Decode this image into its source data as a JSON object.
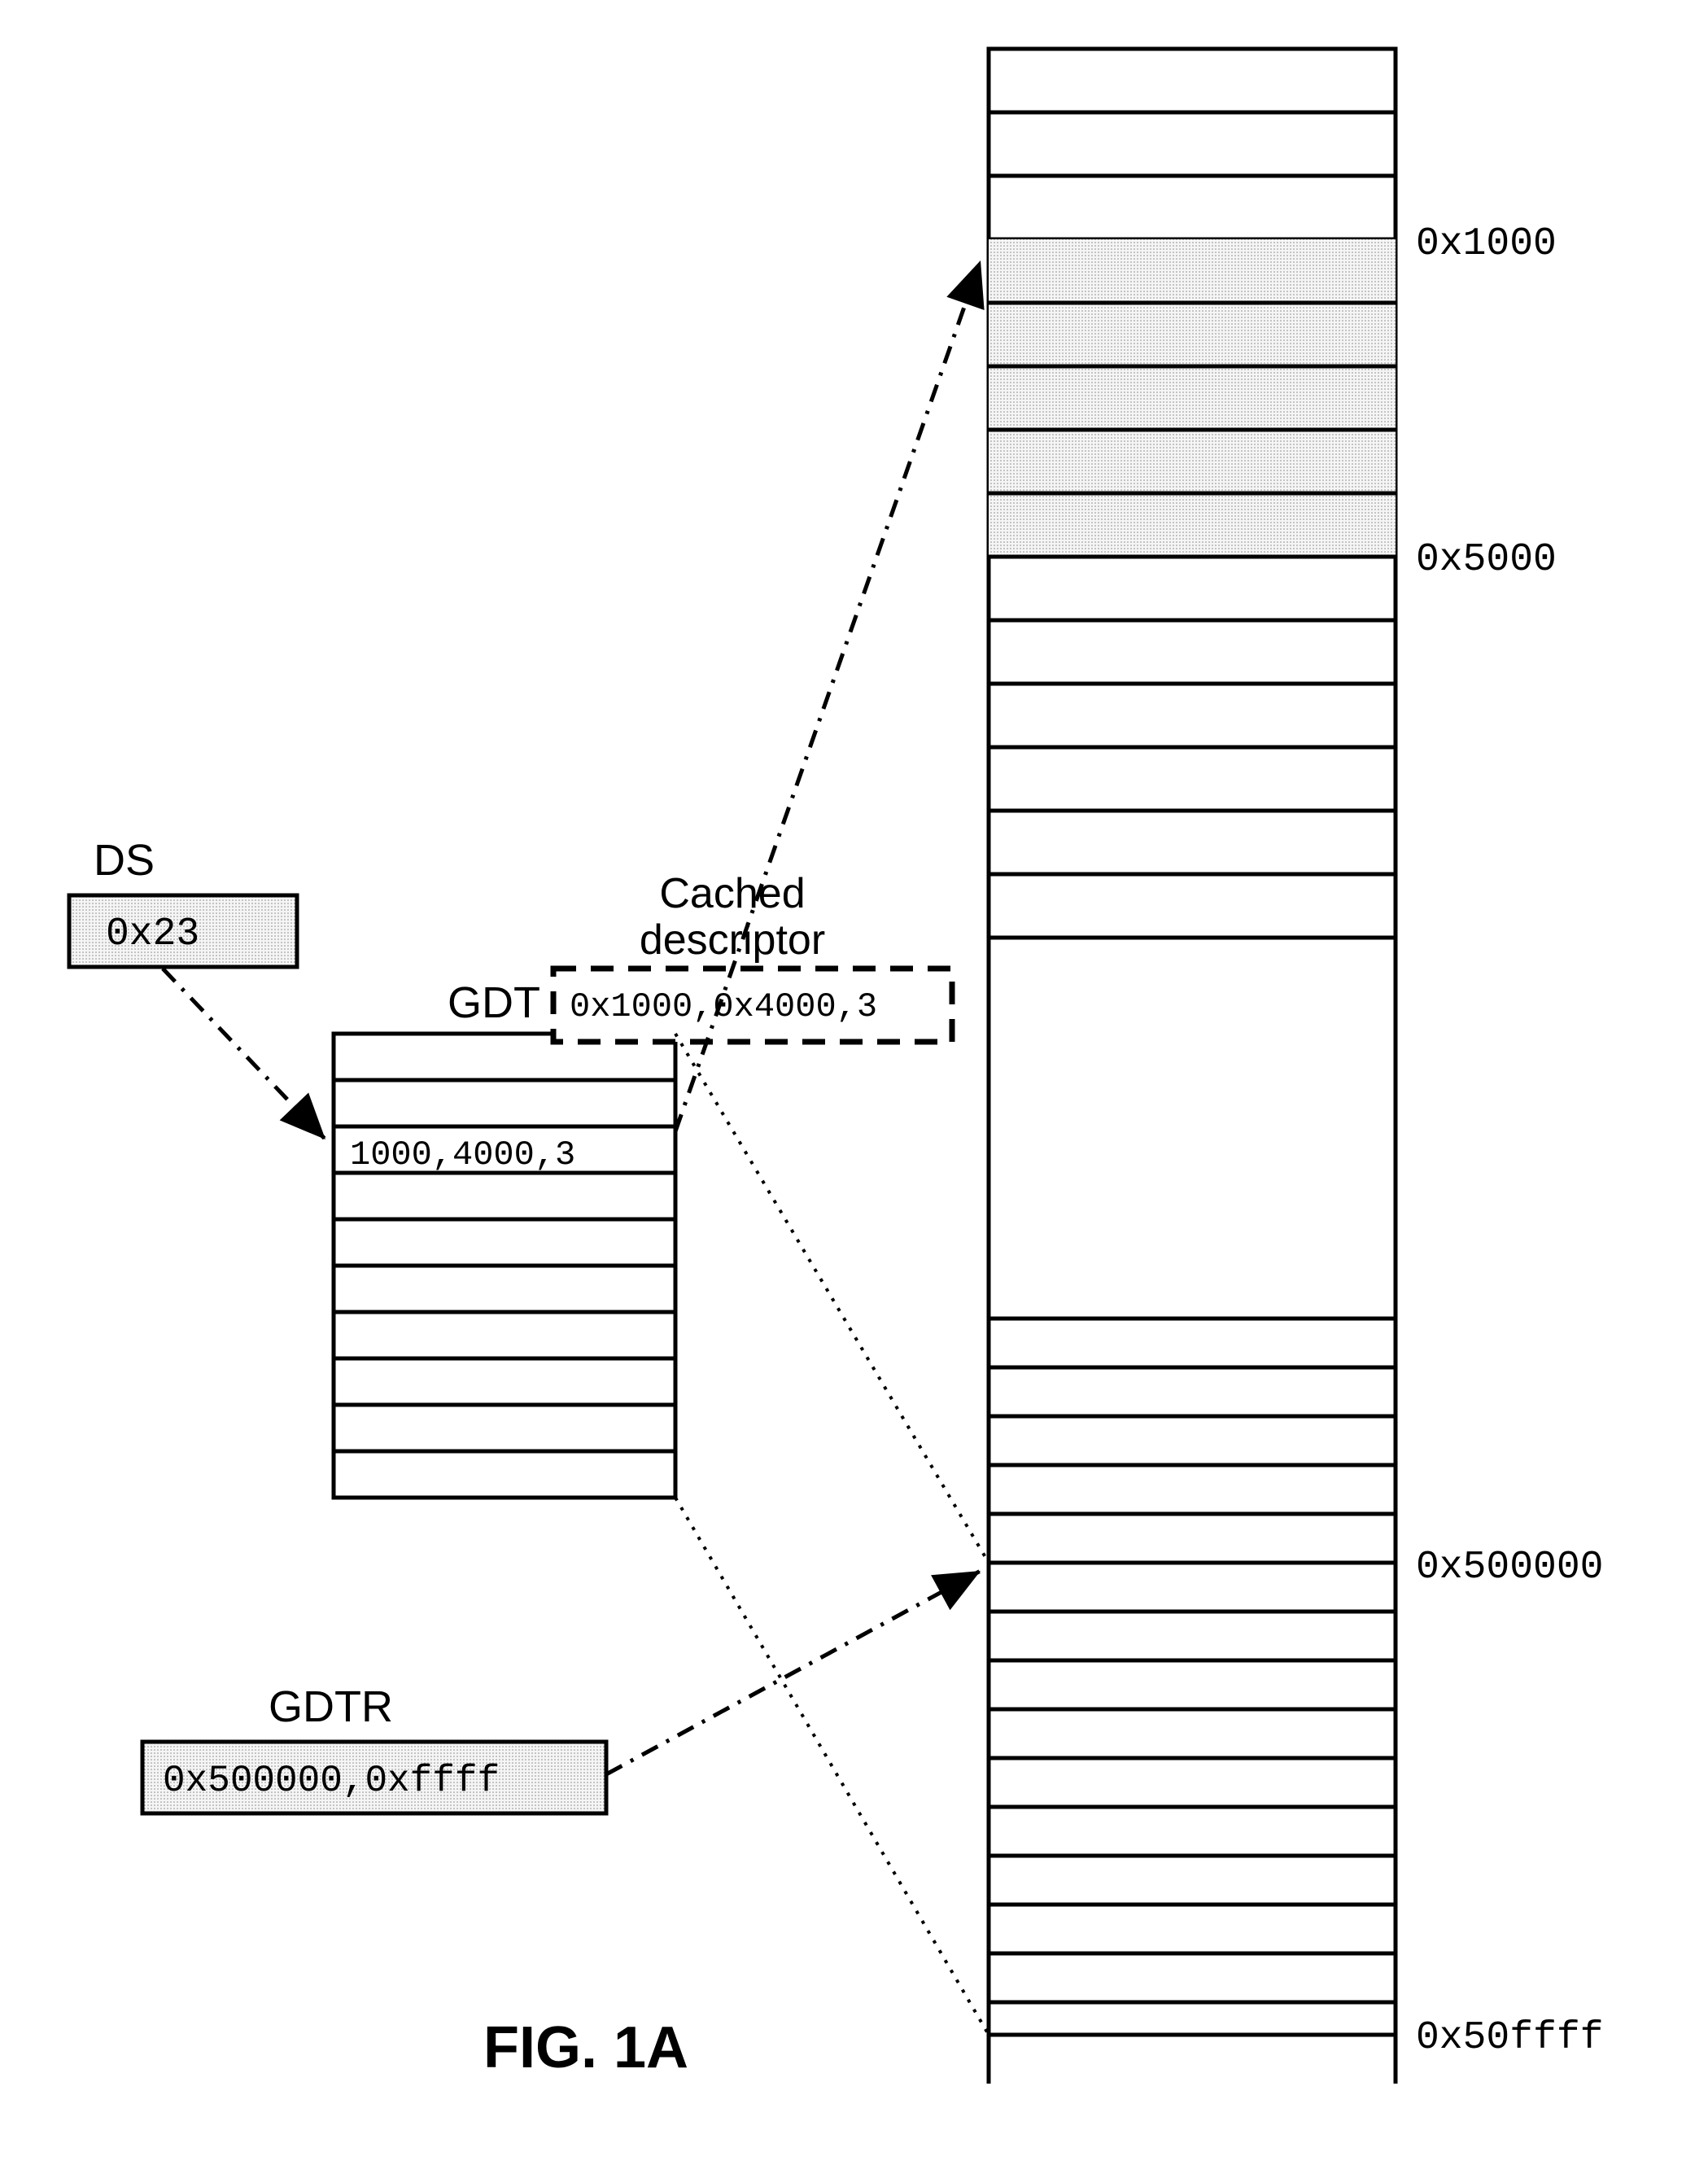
{
  "labels": {
    "ds_title": "DS",
    "ds_value": "0x23",
    "gdt_title": "GDT",
    "gdt_entry": "1000,4000,3",
    "gdtr_title": "GDTR",
    "gdtr_value": "0x500000,0xffff",
    "cached_title1": "Cached",
    "cached_title2": "descriptor",
    "cached_value": "0x1000,0x4000,3",
    "addr_1000": "0x1000",
    "addr_5000": "0x5000",
    "addr_500000": "0x500000",
    "addr_50ffff": "0x50ffff",
    "figure": "FIG. 1A"
  }
}
